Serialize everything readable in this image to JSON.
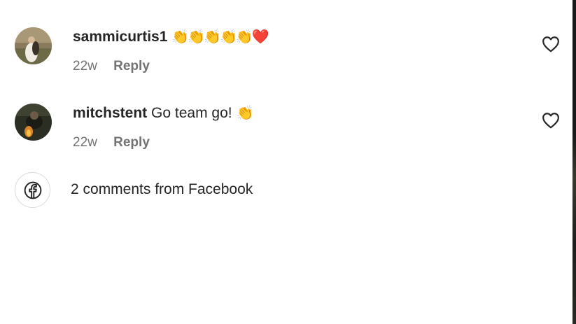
{
  "comments": [
    {
      "username": "sammicurtis1",
      "text": "",
      "emoji": "👏👏👏👏👏❤️",
      "age": "22w",
      "reply_label": "Reply",
      "avatar_icon": "user-avatar-photo",
      "like_icon": "heart-outline-icon"
    },
    {
      "username": "mitchstent",
      "text": "Go team go!",
      "emoji": "👏",
      "age": "22w",
      "reply_label": "Reply",
      "avatar_icon": "user-avatar-photo",
      "like_icon": "heart-outline-icon"
    }
  ],
  "facebook": {
    "icon": "facebook-icon",
    "label": "2 comments from Facebook"
  },
  "colors": {
    "text": "#262626",
    "secondary": "#737373",
    "border": "#dbdbdb",
    "background": "#ffffff"
  }
}
